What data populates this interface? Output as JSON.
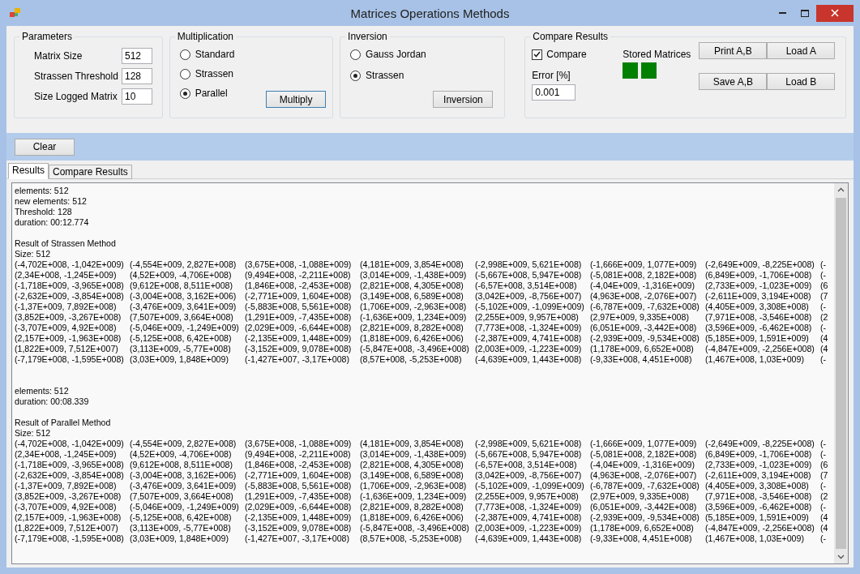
{
  "window": {
    "title": "Matrices Operations Methods"
  },
  "parameters": {
    "title": "Parameters",
    "fields": [
      {
        "label": "Matrix Size",
        "value": "512"
      },
      {
        "label": "Strassen Threshold",
        "value": "128"
      },
      {
        "label": "Size Logged Matrix",
        "value": "10"
      }
    ]
  },
  "multiplication": {
    "title": "Multiplication",
    "options": [
      {
        "label": "Standard",
        "selected": false
      },
      {
        "label": "Strassen",
        "selected": false
      },
      {
        "label": "Parallel",
        "selected": true
      }
    ],
    "button": "Multiply"
  },
  "inversion": {
    "title": "Inversion",
    "options": [
      {
        "label": "Gauss Jordan",
        "selected": false
      },
      {
        "label": "Strassen",
        "selected": true
      }
    ],
    "button": "Inversion"
  },
  "compare_results": {
    "title": "Compare Results",
    "compare": {
      "label": "Compare",
      "checked": true
    },
    "error": {
      "label": "Error [%]",
      "value": "0.001"
    },
    "stored_matrices": {
      "label": "Stored Matrices",
      "slots": [
        {
          "color": "#008000"
        },
        {
          "color": "#008000"
        }
      ]
    },
    "buttons": [
      "Print A,B",
      "Load A",
      "Save A,B",
      "Load B"
    ]
  },
  "clear_button": "Clear",
  "tabs": [
    {
      "label": "Results",
      "selected": true
    },
    {
      "label": "Compare Results",
      "selected": false
    }
  ],
  "results": [
    {
      "info": [
        "elements: 512",
        "new elements: 512",
        "Threshold: 128",
        "duration: 00:12.774"
      ],
      "title": "Result of Strassen Method",
      "size": "Size: 512",
      "rows": [
        [
          "(-4,702E+008, -1,042E+009)",
          "(-4,554E+009, 2,827E+008)",
          "(3,675E+008, -1,088E+009)",
          "(4,181E+009, 3,854E+008)",
          "(-2,998E+009, 5,621E+008)",
          "(-1,666E+009, 1,077E+009)",
          "(-2,649E+009, -8,225E+008)",
          "(-"
        ],
        [
          "(2,34E+008, -1,245E+009)",
          "(4,52E+009, -4,706E+008)",
          "(9,494E+008, -2,211E+008)",
          "(3,014E+009, -1,438E+009)",
          "(-5,667E+008, 5,947E+008)",
          "(-5,081E+008, 2,182E+008)",
          "(6,849E+009, -1,706E+008)",
          "(-"
        ],
        [
          "(-1,718E+009, -3,965E+008)",
          "(9,612E+008, 8,511E+008)",
          "(1,846E+008, -2,453E+008)",
          "(2,821E+008, 4,305E+008)",
          "(-6,57E+008, 3,514E+008)",
          "(-4,04E+009, -1,316E+009)",
          "(2,733E+009, -1,023E+009)",
          "(6"
        ],
        [
          "(-2,632E+009, -3,854E+008)",
          "(-3,004E+008, 3,162E+006)",
          "(-2,771E+009, 1,604E+008)",
          "(3,149E+008, 6,589E+008)",
          "(3,042E+009, -8,756E+007)",
          "(4,963E+008, -2,076E+007)",
          "(-2,611E+009, 3,194E+008)",
          "(7"
        ],
        [
          "(-1,37E+009, 7,892E+008)",
          "(-3,476E+009, 3,641E+009)",
          "(-5,883E+008, 5,561E+008)",
          "(1,706E+009, -2,963E+008)",
          "(-5,102E+009, -1,099E+009)",
          "(-6,787E+009, -7,632E+008)",
          "(4,405E+009, 3,308E+008)",
          "(-"
        ],
        [
          "(3,852E+009, -3,267E+008)",
          "(7,507E+009, 3,664E+008)",
          "(1,291E+009, -7,435E+008)",
          "(-1,636E+009, 1,234E+009)",
          "(2,255E+009, 9,957E+008)",
          "(2,97E+009, 9,335E+008)",
          "(7,971E+008, -3,546E+008)",
          "(2"
        ],
        [
          "(-3,707E+009, 4,92E+008)",
          "(-5,046E+009, -1,249E+009)",
          "(2,029E+009, -6,644E+008)",
          "(2,821E+009, 8,282E+008)",
          "(7,773E+008, -1,324E+009)",
          "(6,051E+009, -3,442E+008)",
          "(3,596E+009, -6,462E+008)",
          "(-"
        ],
        [
          "(2,157E+009, -1,963E+008)",
          "(-5,125E+008, 6,42E+008)",
          "(-2,135E+009, 1,448E+009)",
          "(1,818E+009, 6,426E+006)",
          "(-2,387E+009, 4,741E+008)",
          "(-2,939E+009, -9,534E+008)",
          "(5,185E+009, 1,591E+009)",
          "(4"
        ],
        [
          "(1,822E+009, 7,512E+007)",
          "(3,113E+009, -5,77E+008)",
          "(-3,152E+009, 9,078E+008)",
          "(-5,847E+008, -3,496E+008)",
          "(2,003E+009, -1,223E+009)",
          "(1,178E+009, 6,652E+008)",
          "(-4,847E+009, -2,256E+008)",
          "(4"
        ],
        [
          "(-7,179E+008, -1,595E+008)",
          "(3,03E+009, 1,848E+009)",
          "(-1,427E+007, -3,17E+008)",
          "(8,57E+008, -5,253E+008)",
          "(-4,639E+009, 1,443E+008)",
          "(-9,33E+008, 4,451E+008)",
          "(1,467E+008, 1,03E+009)",
          "(-"
        ]
      ]
    },
    {
      "info": [
        "elements: 512",
        "duration: 00:08.339"
      ],
      "title": "Result of Parallel Method",
      "size": "Size: 512",
      "rows": [
        [
          "(-4,702E+008, -1,042E+009)",
          "(-4,554E+009, 2,827E+008)",
          "(3,675E+008, -1,088E+009)",
          "(4,181E+009, 3,854E+008)",
          "(-2,998E+009, 5,621E+008)",
          "(-1,666E+009, 1,077E+009)",
          "(-2,649E+009, -8,225E+008)",
          "(-"
        ],
        [
          "(2,34E+008, -1,245E+009)",
          "(4,52E+009, -4,706E+008)",
          "(9,494E+008, -2,211E+008)",
          "(3,014E+009, -1,438E+009)",
          "(-5,667E+008, 5,947E+008)",
          "(-5,081E+008, 2,182E+008)",
          "(6,849E+009, -1,706E+008)",
          "(-"
        ],
        [
          "(-1,718E+009, -3,965E+008)",
          "(9,612E+008, 8,511E+008)",
          "(1,846E+008, -2,453E+008)",
          "(2,821E+008, 4,305E+008)",
          "(-6,57E+008, 3,514E+008)",
          "(-4,04E+009, -1,316E+009)",
          "(2,733E+009, -1,023E+009)",
          "(6"
        ],
        [
          "(-2,632E+009, -3,854E+008)",
          "(-3,004E+008, 3,162E+006)",
          "(-2,771E+009, 1,604E+008)",
          "(3,149E+008, 6,589E+008)",
          "(3,042E+009, -8,756E+007)",
          "(4,963E+008, -2,076E+007)",
          "(-2,611E+009, 3,194E+008)",
          "(7"
        ],
        [
          "(-1,37E+009, 7,892E+008)",
          "(-3,476E+009, 3,641E+009)",
          "(-5,883E+008, 5,561E+008)",
          "(1,706E+009, -2,963E+008)",
          "(-5,102E+009, -1,099E+009)",
          "(-6,787E+009, -7,632E+008)",
          "(4,405E+009, 3,308E+008)",
          "(-"
        ],
        [
          "(3,852E+009, -3,267E+008)",
          "(7,507E+009, 3,664E+008)",
          "(1,291E+009, -7,435E+008)",
          "(-1,636E+009, 1,234E+009)",
          "(2,255E+009, 9,957E+008)",
          "(2,97E+009, 9,335E+008)",
          "(7,971E+008, -3,546E+008)",
          "(2"
        ],
        [
          "(-3,707E+009, 4,92E+008)",
          "(-5,046E+009, -1,249E+009)",
          "(2,029E+009, -6,644E+008)",
          "(2,821E+009, 8,282E+008)",
          "(7,773E+008, -1,324E+009)",
          "(6,051E+009, -3,442E+008)",
          "(3,596E+009, -6,462E+008)",
          "(-"
        ],
        [
          "(2,157E+009, -1,963E+008)",
          "(-5,125E+008, 6,42E+008)",
          "(-2,135E+009, 1,448E+009)",
          "(1,818E+009, 6,426E+006)",
          "(-2,387E+009, 4,741E+008)",
          "(-2,939E+009, -9,534E+008)",
          "(5,185E+009, 1,591E+009)",
          "(4"
        ],
        [
          "(1,822E+009, 7,512E+007)",
          "(3,113E+009, -5,77E+008)",
          "(-3,152E+009, 9,078E+008)",
          "(-5,847E+008, -3,496E+008)",
          "(2,003E+009, -1,223E+009)",
          "(1,178E+009, 6,652E+008)",
          "(-4,847E+009, -2,256E+008)",
          "(4"
        ],
        [
          "(-7,179E+008, -1,595E+008)",
          "(3,03E+009, 1,848E+009)",
          "(-1,427E+007, -3,17E+008)",
          "(8,57E+008, -5,253E+008)",
          "(-4,639E+009, 1,443E+008)",
          "(-9,33E+008, 4,451E+008)",
          "(1,467E+008, 1,03E+009)",
          "(-"
        ]
      ]
    }
  ]
}
